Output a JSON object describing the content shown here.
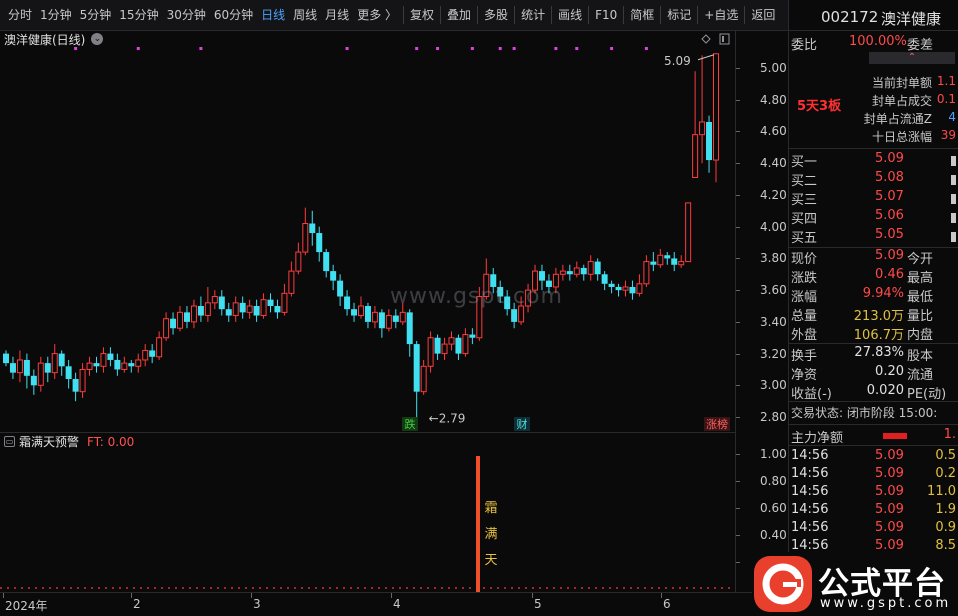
{
  "toolbar": {
    "items": [
      {
        "label": "分时"
      },
      {
        "label": "1分钟"
      },
      {
        "label": "5分钟"
      },
      {
        "label": "15分钟"
      },
      {
        "label": "30分钟"
      },
      {
        "label": "60分钟"
      },
      {
        "label": "日线",
        "state": "selected"
      },
      {
        "label": "周线"
      },
      {
        "label": "月线"
      },
      {
        "label": "更多 〉"
      },
      {
        "label": "复权"
      },
      {
        "label": "叠加"
      },
      {
        "label": "多股"
      },
      {
        "label": "统计"
      },
      {
        "label": "画线"
      },
      {
        "label": "F10"
      },
      {
        "label": "简框"
      },
      {
        "label": "标记"
      },
      {
        "label": "+自选"
      },
      {
        "label": "返回"
      }
    ]
  },
  "kline": {
    "title": "澳洋健康(日线)",
    "y_ticks": [
      "5.00",
      "4.80",
      "4.60",
      "4.40",
      "4.20",
      "4.00",
      "3.80",
      "3.60",
      "3.40",
      "3.20",
      "3.00",
      "2.80"
    ],
    "high_label": "5.09",
    "low_label": "2.79",
    "markers": [
      "跌",
      "财",
      "涨榜"
    ],
    "watermark": "www.gspt.com"
  },
  "indicator": {
    "name": "霜满天预警",
    "ft": "FT: 0.00",
    "y_ticks": [
      "1.00",
      "0.80",
      "0.60",
      "0.40",
      "0.20"
    ],
    "signal_text": [
      "霜",
      "满",
      "天"
    ]
  },
  "date_axis": {
    "labels": [
      "2024年",
      "2",
      "3",
      "4",
      "5",
      "6"
    ]
  },
  "chart_data": {
    "type": "candlestick",
    "title": "澳洋健康(日线)",
    "ylim": [
      2.75,
      5.12
    ],
    "up_color": "#ff3b3b",
    "down_color": "#40e0f0",
    "candles": [
      [
        3.2,
        3.14,
        3.22,
        3.12
      ],
      [
        3.14,
        3.08,
        3.18,
        3.04
      ],
      [
        3.08,
        3.16,
        3.22,
        3.02
      ],
      [
        3.16,
        3.06,
        3.2,
        2.98
      ],
      [
        3.06,
        3.0,
        3.1,
        2.94
      ],
      [
        3.0,
        3.14,
        3.18,
        2.96
      ],
      [
        3.14,
        3.08,
        3.18,
        3.02
      ],
      [
        3.08,
        3.2,
        3.26,
        3.04
      ],
      [
        3.2,
        3.12,
        3.22,
        3.06
      ],
      [
        3.12,
        3.04,
        3.16,
        2.98
      ],
      [
        3.04,
        2.96,
        3.08,
        2.9
      ],
      [
        2.96,
        3.1,
        3.14,
        2.92
      ],
      [
        3.1,
        3.14,
        3.18,
        3.06
      ],
      [
        3.14,
        3.12,
        3.18,
        3.08
      ],
      [
        3.12,
        3.2,
        3.24,
        3.08
      ],
      [
        3.2,
        3.16,
        3.24,
        3.12
      ],
      [
        3.16,
        3.1,
        3.2,
        3.06
      ],
      [
        3.1,
        3.14,
        3.18,
        3.08
      ],
      [
        3.14,
        3.12,
        3.16,
        3.08
      ],
      [
        3.12,
        3.16,
        3.2,
        3.08
      ],
      [
        3.16,
        3.22,
        3.26,
        3.12
      ],
      [
        3.22,
        3.18,
        3.26,
        3.14
      ],
      [
        3.18,
        3.3,
        3.34,
        3.16
      ],
      [
        3.3,
        3.42,
        3.46,
        3.28
      ],
      [
        3.42,
        3.36,
        3.46,
        3.32
      ],
      [
        3.36,
        3.46,
        3.5,
        3.34
      ],
      [
        3.46,
        3.4,
        3.5,
        3.36
      ],
      [
        3.4,
        3.5,
        3.54,
        3.36
      ],
      [
        3.5,
        3.44,
        3.56,
        3.4
      ],
      [
        3.44,
        3.52,
        3.62,
        3.4
      ],
      [
        3.52,
        3.56,
        3.6,
        3.48
      ],
      [
        3.56,
        3.48,
        3.6,
        3.44
      ],
      [
        3.48,
        3.44,
        3.52,
        3.4
      ],
      [
        3.44,
        3.52,
        3.56,
        3.4
      ],
      [
        3.52,
        3.46,
        3.56,
        3.42
      ],
      [
        3.46,
        3.5,
        3.54,
        3.42
      ],
      [
        3.5,
        3.44,
        3.54,
        3.4
      ],
      [
        3.44,
        3.54,
        3.58,
        3.42
      ],
      [
        3.54,
        3.5,
        3.58,
        3.46
      ],
      [
        3.5,
        3.46,
        3.54,
        3.42
      ],
      [
        3.46,
        3.58,
        3.64,
        3.44
      ],
      [
        3.58,
        3.72,
        3.78,
        3.56
      ],
      [
        3.72,
        3.84,
        3.9,
        3.7
      ],
      [
        3.84,
        4.02,
        4.12,
        3.82
      ],
      [
        4.02,
        3.96,
        4.1,
        3.88
      ],
      [
        3.96,
        3.84,
        4.0,
        3.78
      ],
      [
        3.84,
        3.72,
        3.86,
        3.68
      ],
      [
        3.72,
        3.66,
        3.76,
        3.6
      ],
      [
        3.66,
        3.56,
        3.7,
        3.5
      ],
      [
        3.56,
        3.48,
        3.6,
        3.44
      ],
      [
        3.48,
        3.44,
        3.52,
        3.4
      ],
      [
        3.44,
        3.5,
        3.56,
        3.42
      ],
      [
        3.5,
        3.4,
        3.52,
        3.36
      ],
      [
        3.4,
        3.46,
        3.5,
        3.36
      ],
      [
        3.46,
        3.36,
        3.48,
        3.3
      ],
      [
        3.36,
        3.44,
        3.48,
        3.34
      ],
      [
        3.44,
        3.4,
        3.48,
        3.36
      ],
      [
        3.4,
        3.46,
        3.52,
        3.38
      ],
      [
        3.46,
        3.26,
        3.48,
        3.18
      ],
      [
        3.26,
        2.96,
        3.28,
        2.79
      ],
      [
        2.96,
        3.12,
        3.16,
        2.94
      ],
      [
        3.12,
        3.3,
        3.34,
        3.08
      ],
      [
        3.3,
        3.2,
        3.32,
        3.16
      ],
      [
        3.2,
        3.26,
        3.3,
        3.16
      ],
      [
        3.26,
        3.3,
        3.34,
        3.22
      ],
      [
        3.3,
        3.2,
        3.32,
        3.16
      ],
      [
        3.2,
        3.32,
        3.36,
        3.18
      ],
      [
        3.32,
        3.3,
        3.36,
        3.26
      ],
      [
        3.3,
        3.56,
        3.62,
        3.28
      ],
      [
        3.56,
        3.7,
        3.8,
        3.54
      ],
      [
        3.7,
        3.62,
        3.74,
        3.58
      ],
      [
        3.62,
        3.56,
        3.66,
        3.52
      ],
      [
        3.56,
        3.48,
        3.6,
        3.44
      ],
      [
        3.48,
        3.4,
        3.52,
        3.36
      ],
      [
        3.4,
        3.5,
        3.56,
        3.38
      ],
      [
        3.5,
        3.6,
        3.64,
        3.46
      ],
      [
        3.6,
        3.72,
        3.76,
        3.58
      ],
      [
        3.72,
        3.66,
        3.76,
        3.6
      ],
      [
        3.66,
        3.62,
        3.7,
        3.58
      ],
      [
        3.62,
        3.7,
        3.74,
        3.58
      ],
      [
        3.7,
        3.72,
        3.76,
        3.66
      ],
      [
        3.72,
        3.7,
        3.76,
        3.66
      ],
      [
        3.7,
        3.74,
        3.78,
        3.68
      ],
      [
        3.74,
        3.7,
        3.76,
        3.66
      ],
      [
        3.7,
        3.78,
        3.82,
        3.66
      ],
      [
        3.78,
        3.7,
        3.8,
        3.66
      ],
      [
        3.7,
        3.64,
        3.72,
        3.6
      ],
      [
        3.64,
        3.62,
        3.66,
        3.58
      ],
      [
        3.62,
        3.6,
        3.64,
        3.56
      ],
      [
        3.6,
        3.62,
        3.66,
        3.56
      ],
      [
        3.62,
        3.58,
        3.66,
        3.54
      ],
      [
        3.58,
        3.64,
        3.7,
        3.56
      ],
      [
        3.64,
        3.78,
        3.82,
        3.62
      ],
      [
        3.78,
        3.76,
        3.84,
        3.72
      ],
      [
        3.76,
        3.82,
        3.86,
        3.74
      ],
      [
        3.82,
        3.8,
        3.84,
        3.76
      ],
      [
        3.8,
        3.76,
        3.84,
        3.72
      ],
      [
        3.76,
        3.78,
        3.82,
        3.74
      ],
      [
        3.78,
        4.15,
        4.15,
        3.78
      ],
      [
        4.31,
        4.58,
        4.98,
        4.31
      ],
      [
        4.58,
        4.66,
        5.08,
        4.4
      ],
      [
        4.66,
        4.42,
        4.7,
        4.34
      ],
      [
        4.42,
        5.09,
        5.09,
        4.28
      ]
    ]
  },
  "top_markers": [
    10,
    19,
    28,
    49,
    59,
    62,
    67,
    71,
    73,
    79,
    82,
    87,
    92
  ],
  "panel": {
    "code": "002172",
    "name": "澳洋健康",
    "weibi": {
      "label": "委比",
      "value": "100.00%",
      "label2": "委差"
    },
    "streak": "5天3板",
    "seal": [
      {
        "label": "当前封单额",
        "value": "1.1"
      },
      {
        "label": "封单占成交",
        "value": "0.1"
      },
      {
        "label": "封单占流通Z",
        "value": "4"
      },
      {
        "label": "十日总涨幅",
        "value": "39"
      }
    ],
    "bids": [
      {
        "label": "买一",
        "price": "5.09"
      },
      {
        "label": "买二",
        "price": "5.08"
      },
      {
        "label": "买三",
        "price": "5.07"
      },
      {
        "label": "买四",
        "price": "5.06"
      },
      {
        "label": "买五",
        "price": "5.05"
      }
    ],
    "stats": [
      {
        "l1": "现价",
        "v1": "5.09",
        "l2": "今开"
      },
      {
        "l1": "涨跌",
        "v1": "0.46",
        "l2": "最高"
      },
      {
        "l1": "涨幅",
        "v1": "9.94%",
        "l2": "最低"
      },
      {
        "l1": "总量",
        "v1": "213.0万",
        "l2": "量比"
      },
      {
        "l1": "外盘",
        "v1": "106.7万",
        "l2": "内盘"
      }
    ],
    "stats2": [
      {
        "l1": "换手",
        "v1": "27.83%",
        "l2": "股本"
      },
      {
        "l1": "净资",
        "v1": "0.20",
        "l2": "流通"
      },
      {
        "l1": "收益(-)",
        "v1": "0.020",
        "l2": "PE(动)"
      }
    ],
    "trade_state": "交易状态: 闭市阶段 15:00:",
    "main_flow": {
      "label": "主力净额",
      "value": "1."
    },
    "ticks": [
      {
        "time": "14:56",
        "price": "5.09",
        "vol": "0.5"
      },
      {
        "time": "14:56",
        "price": "5.09",
        "vol": "0.2"
      },
      {
        "time": "14:56",
        "price": "5.09",
        "vol": "11.0"
      },
      {
        "time": "14:56",
        "price": "5.09",
        "vol": "1.9"
      },
      {
        "time": "14:56",
        "price": "5.09",
        "vol": "0.9"
      },
      {
        "time": "14:56",
        "price": "5.09",
        "vol": "8.5"
      }
    ]
  },
  "logo": {
    "text": "公式平台",
    "url": "www.gspt.com"
  }
}
